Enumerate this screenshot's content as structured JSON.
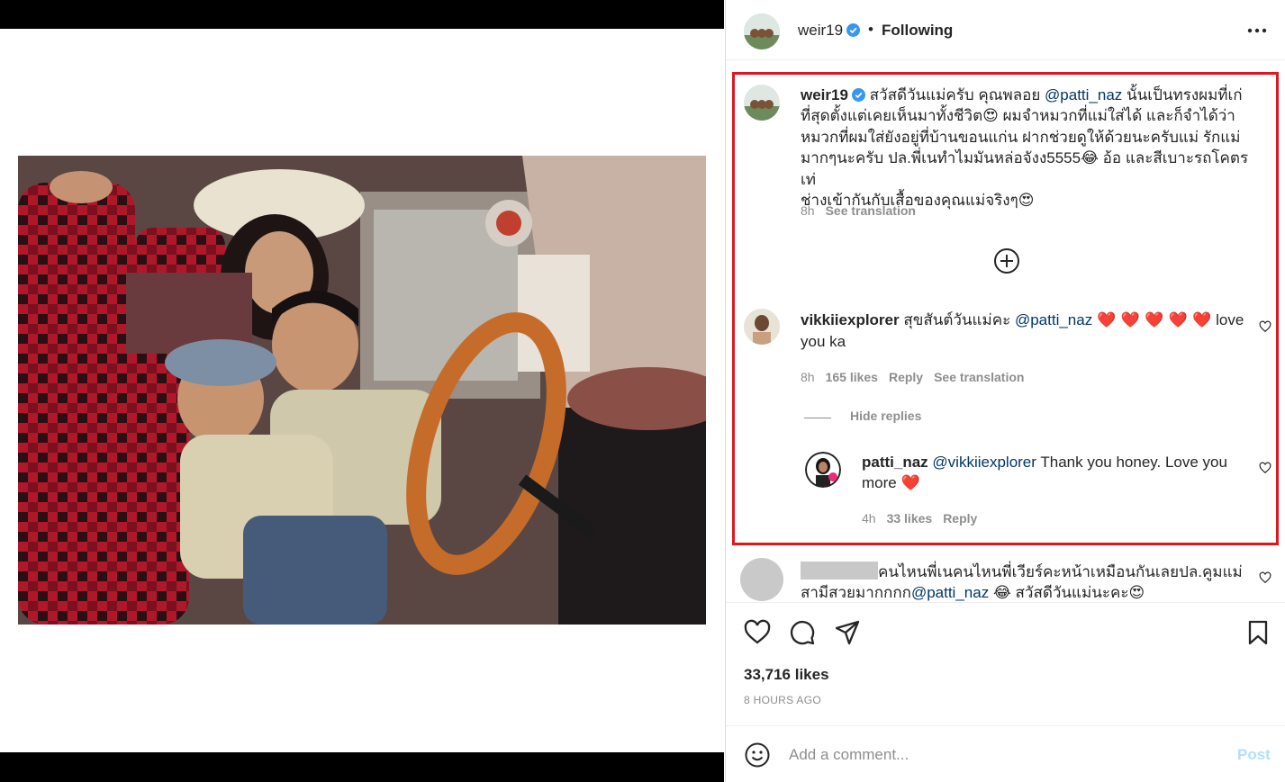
{
  "colors": {
    "highlight": "#e0161f",
    "mention": "#00376b",
    "verified": "#3897f0",
    "heart": "#ed1c24",
    "post": "#b2dffc"
  },
  "header": {
    "username": "weir19",
    "separator": "•",
    "follow_status": "Following",
    "more_icon": "more-icon"
  },
  "caption": {
    "username": "weir19",
    "text_before": "สวัสดีวันแม่ครับ คุณพลอย ",
    "mention": "@patti_naz",
    "text_line1_after": " นั้นเป็นทรงผมที่เก่",
    "line2": "ที่สุดตั้งแต่เคยเห็นมาทั้งชีวิต",
    "emoji1": "😍",
    "line2b": " ผมจำหมวกที่แม่ใส่ได้ และก็จำได้ว่า",
    "line3": "หมวกที่ผมใส่ยังอยู่ที่บ้านขอนแก่น ฝากช่วยดูให้ด้วยนะครับแม่ รักแม่",
    "line4": "มากๆนะครับ ปล.พี่เนทำไมมันหล่อจังง5555",
    "emoji2": "😂",
    "line4b": " อ้อ และสีเบาะรถโคตรเท่",
    "line5": "ช่างเข้ากันกับเสื้อของคุณแม่จริงๆ",
    "emoji3": "😍",
    "time": "8h",
    "see_translation": "See translation"
  },
  "load_more": "load-more-icon",
  "comment1": {
    "username": "vikkiiexplorer",
    "text_before": " สุขสันต์วันแม่คะ ",
    "mention": "@patti_naz",
    "hearts": "❤️ ❤️ ❤️ ❤️ ❤️",
    "text_after": " love",
    "line2": "you ka",
    "time": "8h",
    "likes": "165 likes",
    "reply": "Reply",
    "see_translation": "See translation",
    "hide_replies": "Hide replies"
  },
  "reply1": {
    "username": "patti_naz",
    "mention": "@vikkiiexplorer",
    "text": " Thank you honey. Love you",
    "line2": "more ",
    "heart": "❤️",
    "time": "4h",
    "likes": "33 likes",
    "reply": "Reply"
  },
  "comment2": {
    "line1": "คนไหนพี่เนคนไหนพี่เวียร์คะหน้าเหมือนกันเลยปล.คูมแม่",
    "line2_before": "สามีสวยมากกกก",
    "mention": "@patti_naz",
    "emoji1": "😂",
    "line2_after": " สวัสดีวันแม่นะคะ",
    "emoji2": "😍"
  },
  "actions": {
    "like": "heart-icon",
    "comment": "comment-icon",
    "share": "share-icon",
    "save": "bookmark-icon"
  },
  "likes": "33,716 likes",
  "posted": "8 HOURS AGO",
  "add_comment": {
    "placeholder": "Add a comment...",
    "post": "Post",
    "emoji_icon": "smiley-icon"
  }
}
